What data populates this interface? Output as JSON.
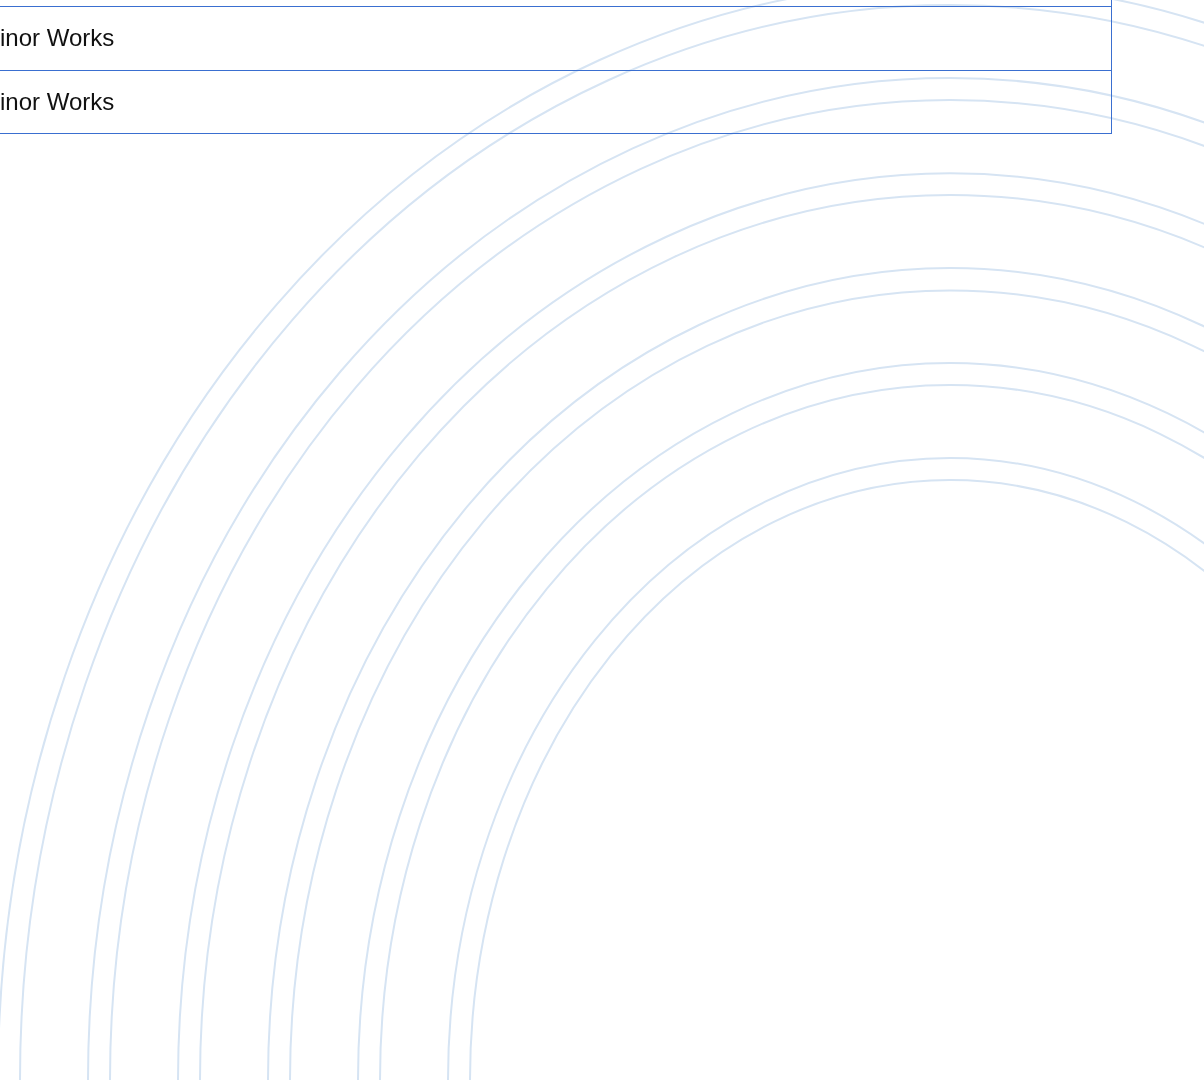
{
  "table": {
    "rows": [
      {
        "cell": "inor Works"
      },
      {
        "cell": "inor Works"
      }
    ]
  }
}
